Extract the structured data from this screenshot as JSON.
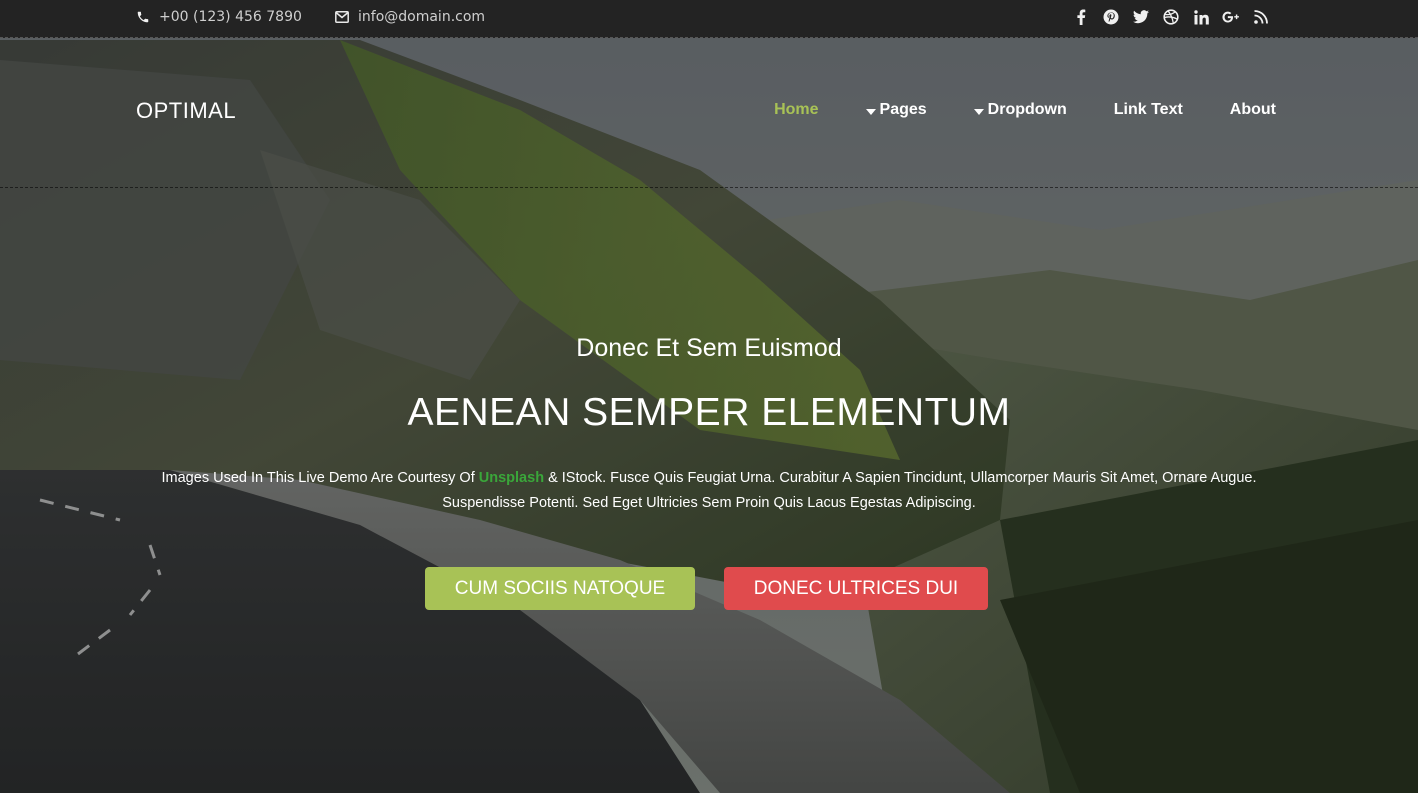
{
  "topbar": {
    "phone": "+00 (123) 456 7890",
    "email": "info@domain.com",
    "socials": [
      "facebook-icon",
      "pinterest-icon",
      "twitter-icon",
      "dribbble-icon",
      "linkedin-icon",
      "google-plus-icon",
      "rss-icon"
    ]
  },
  "navbar": {
    "brand": "OPTIMAL",
    "items": [
      {
        "label": "Home",
        "active": true
      },
      {
        "label": "Pages",
        "dropdown": true
      },
      {
        "label": "Dropdown",
        "dropdown": true
      },
      {
        "label": "Link Text"
      },
      {
        "label": "About"
      }
    ]
  },
  "hero": {
    "subtitle": "Donec Et Sem Euismod",
    "title": "AENEAN SEMPER ELEMENTUM",
    "desc_before": "Images Used In This Live Demo Are Courtesy Of ",
    "desc_link": "Unsplash",
    "desc_after": " & IStock. Fusce Quis Feugiat Urna. Curabitur A Sapien Tincidunt, Ullamcorper Mauris Sit Amet, Ornare Augue. Suspendisse Potenti. Sed Eget Ultricies Sem Proin Quis Lacus Egestas Adipiscing.",
    "primary_button": "CUM SOCIIS NATOQUE",
    "secondary_button": "DONEC ULTRICES DUI"
  },
  "colors": {
    "accent": "#a8c256",
    "danger": "#e04b4d",
    "link": "#3aa63a",
    "topbar_bg": "#232323"
  }
}
